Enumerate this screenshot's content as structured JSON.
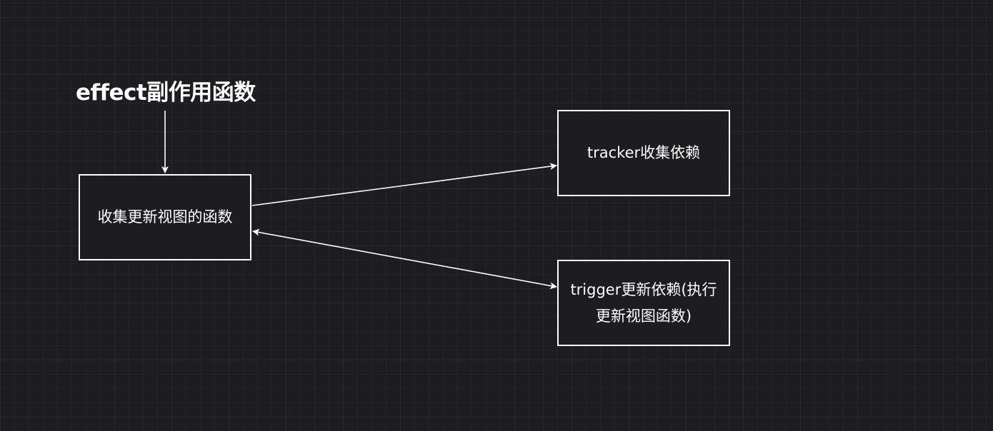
{
  "diagram": {
    "title": "effect副作用函数",
    "nodes": {
      "collect": {
        "label": "收集更新视图的函数"
      },
      "tracker": {
        "label": "tracker收集依赖"
      },
      "trigger": {
        "label_line1": "trigger更新依赖(执行",
        "label_line2": "更新视图函数)"
      }
    },
    "edges": [
      {
        "from": "title",
        "to": "collect",
        "direction": "forward"
      },
      {
        "from": "collect",
        "to": "tracker",
        "direction": "forward"
      },
      {
        "from": "collect",
        "to": "trigger",
        "direction": "both"
      }
    ]
  },
  "colors": {
    "background": "#1d1c21",
    "grid": "#2c2b31",
    "stroke": "#ffffff",
    "text": "#ffffff"
  }
}
